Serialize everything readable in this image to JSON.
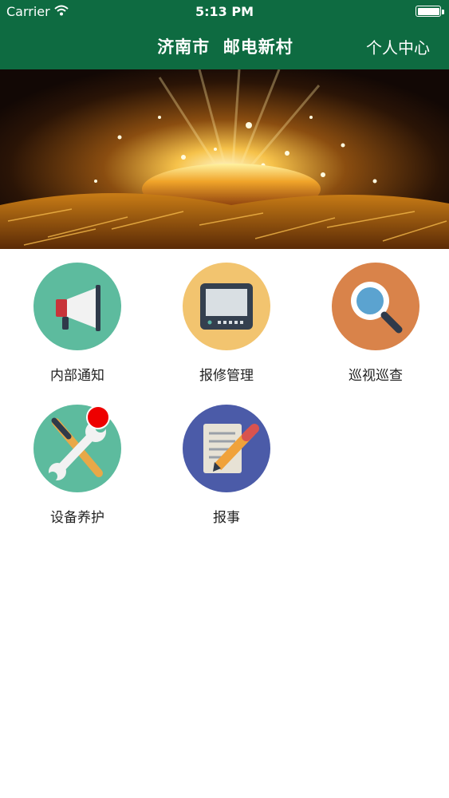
{
  "status_bar": {
    "carrier": "Carrier",
    "time": "5:13 PM"
  },
  "nav": {
    "title": "济南市  邮电新村",
    "right_link": "个人中心",
    "background": "#0e6b41"
  },
  "menu": {
    "items": [
      {
        "label": "内部通知",
        "icon": "megaphone-icon",
        "color": "#5dbb9e"
      },
      {
        "label": "报修管理",
        "icon": "monitor-icon",
        "color": "#f2c46f"
      },
      {
        "label": "巡视巡查",
        "icon": "magnifier-icon",
        "color": "#d9834a"
      },
      {
        "label": "设备养护",
        "icon": "tools-icon",
        "color": "#5dbb9e",
        "badge": true,
        "badge_color": "#ee0000"
      },
      {
        "label": "报事",
        "icon": "report-pen-icon",
        "color": "#4b5ba8"
      }
    ]
  }
}
